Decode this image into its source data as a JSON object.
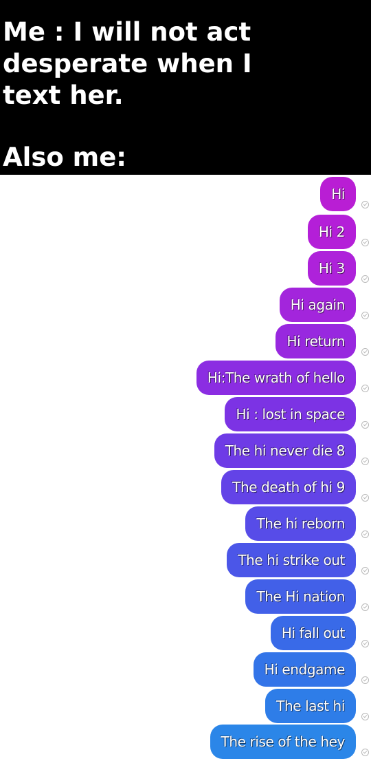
{
  "caption": {
    "lines": [
      "Me : I will not act",
      "desperate when I",
      "text her.",
      "Also me:"
    ]
  },
  "messages": [
    {
      "text": "Hi",
      "color": "#b91ed4"
    },
    {
      "text": "Hi 2",
      "color": "#b41fd8"
    },
    {
      "text": "Hi 3",
      "color": "#ae22da"
    },
    {
      "text": "Hi again",
      "color": "#a325dc"
    },
    {
      "text": "Hi return",
      "color": "#9828df"
    },
    {
      "text": "Hi:The wrath of hello",
      "color": "#8b2de2"
    },
    {
      "text": "Hi : lost in space",
      "color": "#7c33e4"
    },
    {
      "text": "The hi never die 8",
      "color": "#6e3be6"
    },
    {
      "text": "The death of hi 9",
      "color": "#6343e7"
    },
    {
      "text": "The hi reborn",
      "color": "#574ce8"
    },
    {
      "text": "The hi strike out",
      "color": "#4b56e8"
    },
    {
      "text": "The Hi nation",
      "color": "#4260e8"
    },
    {
      "text": "Hi fall out",
      "color": "#396ae8"
    },
    {
      "text": "Hi endgame",
      "color": "#3374e8"
    },
    {
      "text": "The last hi",
      "color": "#2e7de8"
    },
    {
      "text": "The rise of the hey",
      "color": "#2b86e8"
    }
  ]
}
